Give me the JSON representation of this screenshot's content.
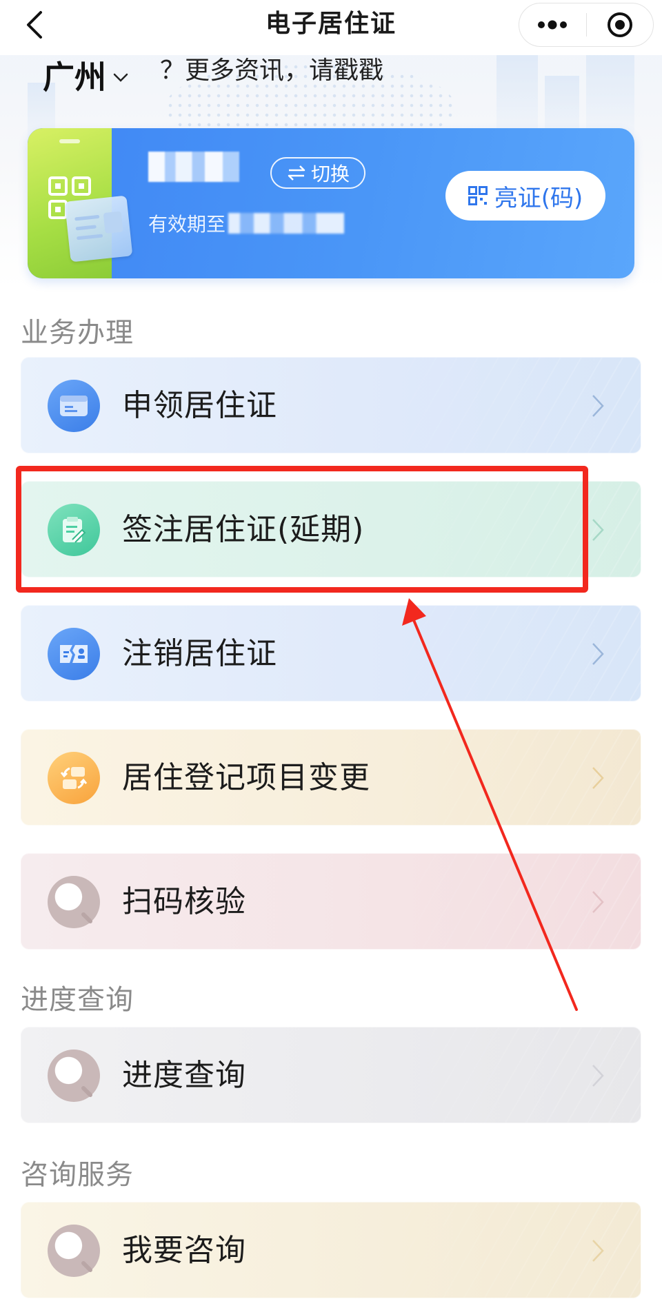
{
  "navbar": {
    "title": "电子居住证",
    "back_icon": "chevron-left-icon",
    "more_icon": "more-dots-icon",
    "close_icon": "target-close-icon"
  },
  "header": {
    "city": "广州",
    "promo": "？更多资讯，请戳戳"
  },
  "card": {
    "name": "",
    "switch_label": "切换",
    "validity_label": "有效期至",
    "validity_date": "",
    "show_button_label": "亮证(码)",
    "accent_color": "#3f86f4"
  },
  "sections": {
    "business": {
      "title": "业务办理",
      "items": [
        {
          "label": "申领居住证",
          "icon": "id-card-icon",
          "color": "#4a8bf0"
        },
        {
          "label": "签注居住证(延期)",
          "icon": "sign-document-icon",
          "color": "#3fc79a"
        },
        {
          "label": "注销居住证",
          "icon": "cancel-card-icon",
          "color": "#4a8bf0"
        },
        {
          "label": "居住登记项目变更",
          "icon": "change-swap-icon",
          "color": "#f8a33c"
        },
        {
          "label": "扫码核验",
          "icon": "search-icon",
          "color": "#c9b8b8"
        }
      ]
    },
    "progress": {
      "title": "进度查询",
      "items": [
        {
          "label": "进度查询",
          "icon": "search-icon",
          "color": "#c9b8b8"
        }
      ]
    },
    "consult": {
      "title": "咨询服务",
      "items": [
        {
          "label": "我要咨询",
          "icon": "search-icon",
          "color": "#c9b8b8"
        }
      ]
    }
  },
  "annotation": {
    "highlight_color": "#f2281e"
  }
}
